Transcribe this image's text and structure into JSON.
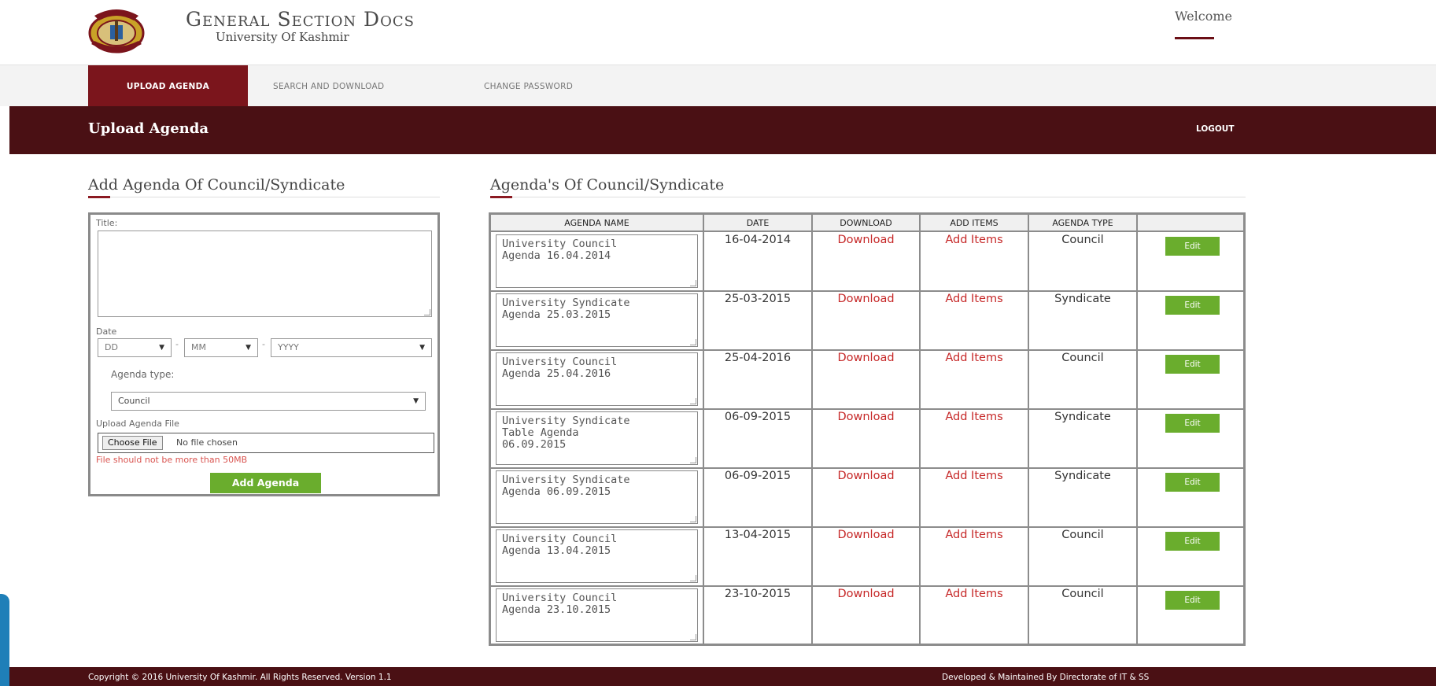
{
  "header": {
    "title": "General Section Docs",
    "subtitle": "University Of Kashmir",
    "welcome": "Welcome"
  },
  "nav": {
    "items": [
      {
        "label": "UPLOAD AGENDA",
        "active": true
      },
      {
        "label": "SEARCH AND DOWNLOAD",
        "active": false
      },
      {
        "label": "CHANGE PASSWORD",
        "active": false
      }
    ]
  },
  "pagebar": {
    "title": "Upload Agenda",
    "logout": "LOGOUT"
  },
  "form": {
    "heading": "Add Agenda Of Council/Syndicate",
    "title_label": "Title:",
    "title_value": "",
    "date_label": "Date",
    "day_placeholder": "DD",
    "month_placeholder": "MM",
    "year_placeholder": "YYYY",
    "agenda_type_label": "Agenda type:",
    "agenda_type_value": "Council",
    "upload_label": "Upload Agenda File",
    "choose_file": "Choose File",
    "file_status": "No file chosen",
    "file_warning": "File should not be more than 50MB",
    "submit": "Add Agenda"
  },
  "table": {
    "heading": "Agenda's Of Council/Syndicate",
    "columns": [
      "AGENDA NAME",
      "DATE",
      "DOWNLOAD",
      "ADD ITEMS",
      "AGENDA TYPE",
      ""
    ],
    "rows": [
      {
        "name": "University Council\nAgenda 16.04.2014",
        "date": "16-04-2014",
        "download": "Download",
        "add_items": "Add Items",
        "type": "Council",
        "edit": "Edit"
      },
      {
        "name": "University Syndicate\nAgenda 25.03.2015",
        "date": "25-03-2015",
        "download": "Download",
        "add_items": "Add Items",
        "type": "Syndicate",
        "edit": "Edit"
      },
      {
        "name": "University Council\nAgenda 25.04.2016",
        "date": "25-04-2016",
        "download": "Download",
        "add_items": "Add Items",
        "type": "Council",
        "edit": "Edit"
      },
      {
        "name": "University Syndicate\nTable Agenda\n06.09.2015",
        "date": "06-09-2015",
        "download": "Download",
        "add_items": "Add Items",
        "type": "Syndicate",
        "edit": "Edit"
      },
      {
        "name": "University Syndicate\nAgenda 06.09.2015",
        "date": "06-09-2015",
        "download": "Download",
        "add_items": "Add Items",
        "type": "Syndicate",
        "edit": "Edit"
      },
      {
        "name": "University Council\nAgenda 13.04.2015",
        "date": "13-04-2015",
        "download": "Download",
        "add_items": "Add Items",
        "type": "Council",
        "edit": "Edit"
      },
      {
        "name": "University Council\nAgenda 23.10.2015",
        "date": "23-10-2015",
        "download": "Download",
        "add_items": "Add Items",
        "type": "Council",
        "edit": "Edit"
      }
    ]
  },
  "footer": {
    "copyright": "Copyright © 2016 University Of Kashmir. All Rights Reserved. Version 1.1",
    "developed": "Developed & Maintained By Directorate of IT & SS"
  },
  "colors": {
    "maroon": "#4a1014",
    "nav_active": "#7b151c",
    "green_button": "#6aad2d",
    "link_red": "#c62828"
  }
}
